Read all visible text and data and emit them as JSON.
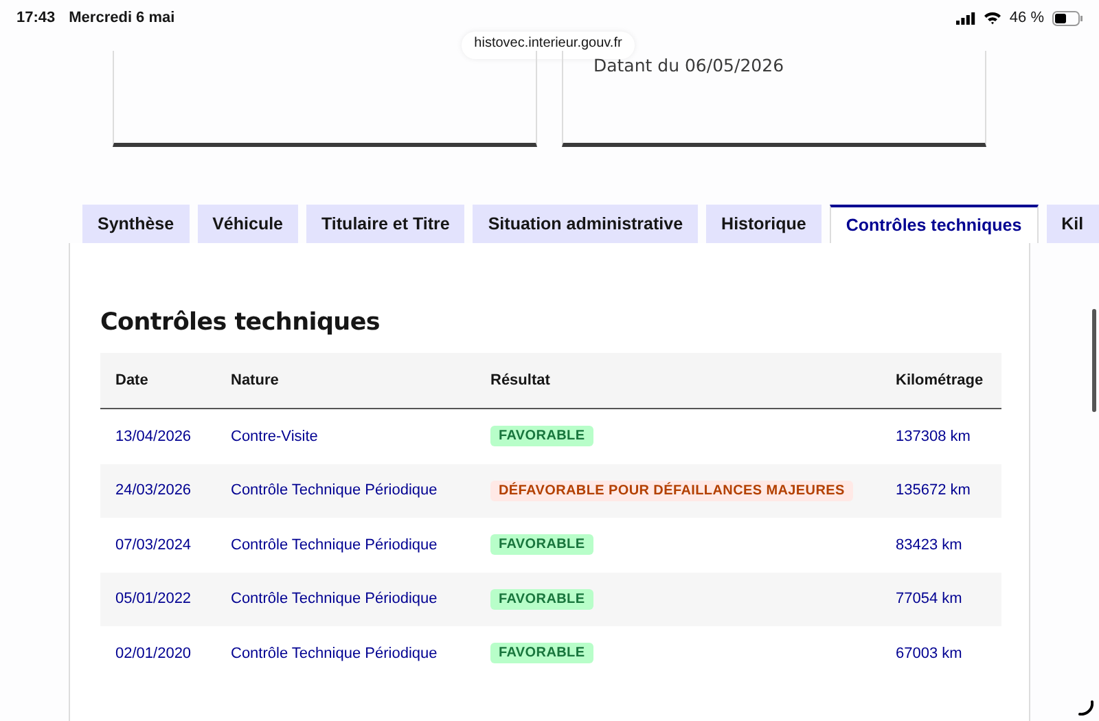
{
  "status_bar": {
    "time": "17:43",
    "date": "Mercredi 6 mai",
    "battery": "46 %"
  },
  "url": "histovec.interieur.gouv.fr",
  "info_card_text": "Datant du 06/05/2026",
  "tabs": [
    {
      "label": "Synthèse",
      "selected": false
    },
    {
      "label": "Véhicule",
      "selected": false
    },
    {
      "label": "Titulaire et Titre",
      "selected": false
    },
    {
      "label": "Situation administrative",
      "selected": false
    },
    {
      "label": "Historique",
      "selected": false
    },
    {
      "label": "Contrôles techniques",
      "selected": true
    },
    {
      "label": "Kil",
      "selected": false
    }
  ],
  "section_title": "Contrôles techniques",
  "table": {
    "columns": [
      "Date",
      "Nature",
      "Résultat",
      "Kilométrage"
    ],
    "rows": [
      {
        "date": "13/04/2026",
        "nature": "Contre-Visite",
        "result": "FAVORABLE",
        "kind": "favorable",
        "km": "137308 km"
      },
      {
        "date": "24/03/2026",
        "nature": "Contrôle Technique Périodique",
        "result": "DÉFAVORABLE POUR DÉFAILLANCES MAJEURES",
        "kind": "unfavorable",
        "km": "135672 km"
      },
      {
        "date": "07/03/2024",
        "nature": "Contrôle Technique Périodique",
        "result": "FAVORABLE",
        "kind": "favorable",
        "km": "83423 km"
      },
      {
        "date": "05/01/2022",
        "nature": "Contrôle Technique Périodique",
        "result": "FAVORABLE",
        "kind": "favorable",
        "km": "77054 km"
      },
      {
        "date": "02/01/2020",
        "nature": "Contrôle Technique Périodique",
        "result": "FAVORABLE",
        "kind": "favorable",
        "km": "67003 km"
      }
    ]
  }
}
